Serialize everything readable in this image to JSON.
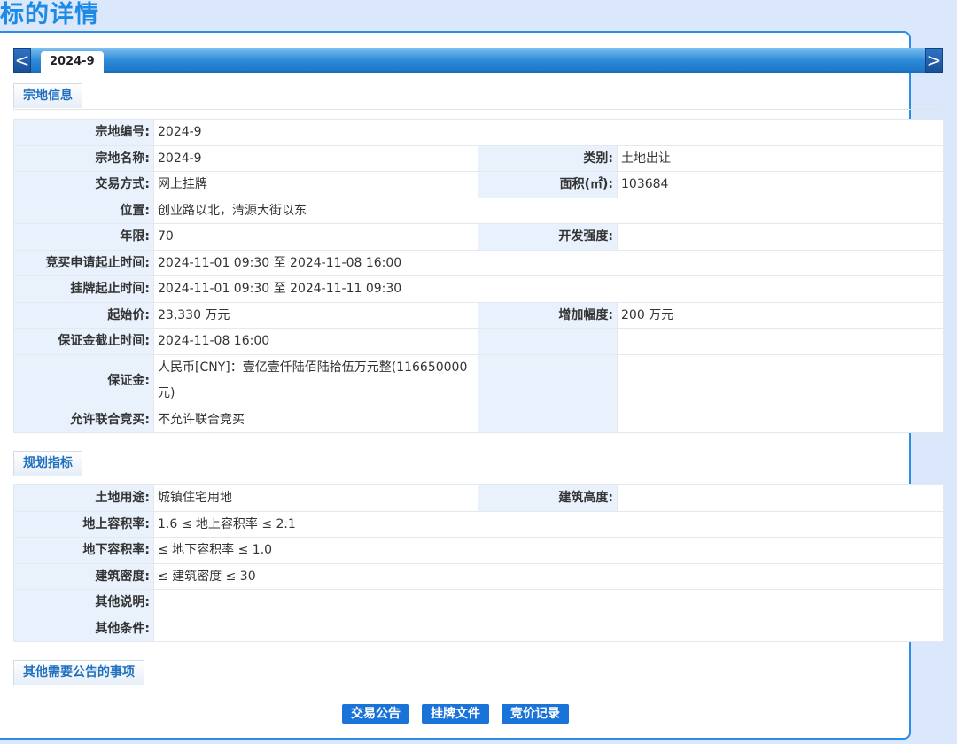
{
  "page": {
    "title": "标的详情"
  },
  "tabs": {
    "prev_icon": "<",
    "next_icon": ">",
    "active": "2024-9"
  },
  "sections": {
    "land": "宗地信息",
    "planning": "规划指标",
    "other": "其他需要公告的事项"
  },
  "land_info": {
    "labels": {
      "parcel_no": "宗地编号:",
      "parcel_name": "宗地名称:",
      "category": "类别:",
      "trade_method": "交易方式:",
      "area": "面积(㎡):",
      "location": "位置:",
      "term": "年限:",
      "dev_intensity": "开发强度:",
      "bid_apply_period": "竞买申请起止时间:",
      "listing_period": "挂牌起止时间:",
      "starting_price": "起始价:",
      "increment": "增加幅度:",
      "deposit_deadline": "保证金截止时间:",
      "deposit": "保证金:",
      "joint_bid": "允许联合竞买:"
    },
    "values": {
      "parcel_no": "2024-9",
      "parcel_name": "2024-9",
      "category": "土地出让",
      "trade_method": "网上挂牌",
      "area": "103684",
      "location": "创业路以北，清源大街以东",
      "term": "70",
      "dev_intensity": "",
      "bid_apply_period": "2024-11-01 09:30 至 2024-11-08 16:00",
      "listing_period": "2024-11-01 09:30 至 2024-11-11 09:30",
      "starting_price": "23,330 万元",
      "increment": "200 万元",
      "deposit_deadline": "2024-11-08 16:00",
      "deposit": "人民币[CNY]：壹亿壹仟陆佰陆拾伍万元整(116650000元)",
      "joint_bid": "不允许联合竞买"
    }
  },
  "planning": {
    "labels": {
      "land_use": "土地用途:",
      "building_height": "建筑高度:",
      "far_above": "地上容积率:",
      "far_below": "地下容积率:",
      "building_density": "建筑密度:",
      "other_notes": "其他说明:",
      "other_conditions": "其他条件:"
    },
    "values": {
      "land_use": "城镇住宅用地",
      "building_height": "",
      "far_above": "1.6 ≤ 地上容积率 ≤ 2.1",
      "far_below": "≤ 地下容积率 ≤ 1.0",
      "building_density": "≤ 建筑密度 ≤ 30",
      "other_notes": "",
      "other_conditions": ""
    }
  },
  "actions": {
    "announcement": "交易公告",
    "listing_docs": "挂牌文件",
    "bid_records": "竞价记录"
  },
  "colors": {
    "title": "#1d8ae6",
    "tabbar": "#2b8ad8",
    "label_bg": "#e8f1fc",
    "button_bg": "#1a73d9"
  }
}
